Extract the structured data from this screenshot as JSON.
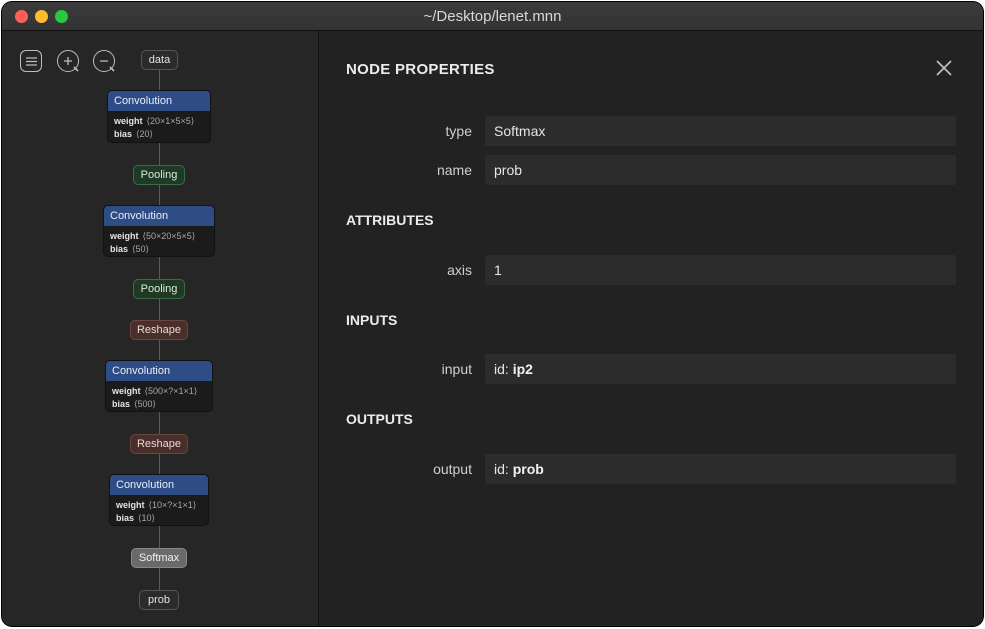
{
  "window": {
    "title": "~/Desktop/lenet.mnn"
  },
  "graph": {
    "input_node": "data",
    "nodes": [
      {
        "type": "Convolution",
        "attrs": [
          {
            "name": "weight",
            "value": "⟨20×1×5×5⟩"
          },
          {
            "name": "bias",
            "value": "⟨20⟩"
          }
        ]
      },
      {
        "type": "Pooling"
      },
      {
        "type": "Convolution",
        "attrs": [
          {
            "name": "weight",
            "value": "⟨50×20×5×5⟩"
          },
          {
            "name": "bias",
            "value": "⟨50⟩"
          }
        ]
      },
      {
        "type": "Pooling"
      },
      {
        "type": "Reshape"
      },
      {
        "type": "Convolution",
        "attrs": [
          {
            "name": "weight",
            "value": "⟨500×?×1×1⟩"
          },
          {
            "name": "bias",
            "value": "⟨500⟩"
          }
        ]
      },
      {
        "type": "Reshape"
      },
      {
        "type": "Convolution",
        "attrs": [
          {
            "name": "weight",
            "value": "⟨10×?×1×1⟩"
          },
          {
            "name": "bias",
            "value": "⟨10⟩"
          }
        ]
      },
      {
        "type": "Softmax"
      }
    ],
    "output_node": "prob"
  },
  "panel": {
    "title": "NODE PROPERTIES",
    "type_label": "type",
    "type_value": "Softmax",
    "name_label": "name",
    "name_value": "prob",
    "attributes_heading": "ATTRIBUTES",
    "axis_label": "axis",
    "axis_value": "1",
    "inputs_heading": "INPUTS",
    "input_label": "input",
    "input_prefix": "id:",
    "input_value": "ip2",
    "outputs_heading": "OUTPUTS",
    "output_label": "output",
    "output_prefix": "id:",
    "output_value": "prob"
  },
  "colors": {
    "conv_header": "#2e4c86",
    "pooling": "#1f3a24",
    "reshape": "#4a2e2a",
    "softmax": "#6a6a6a"
  },
  "icons": [
    "menu-icon",
    "zoom-in-icon",
    "zoom-out-icon",
    "close-icon"
  ]
}
